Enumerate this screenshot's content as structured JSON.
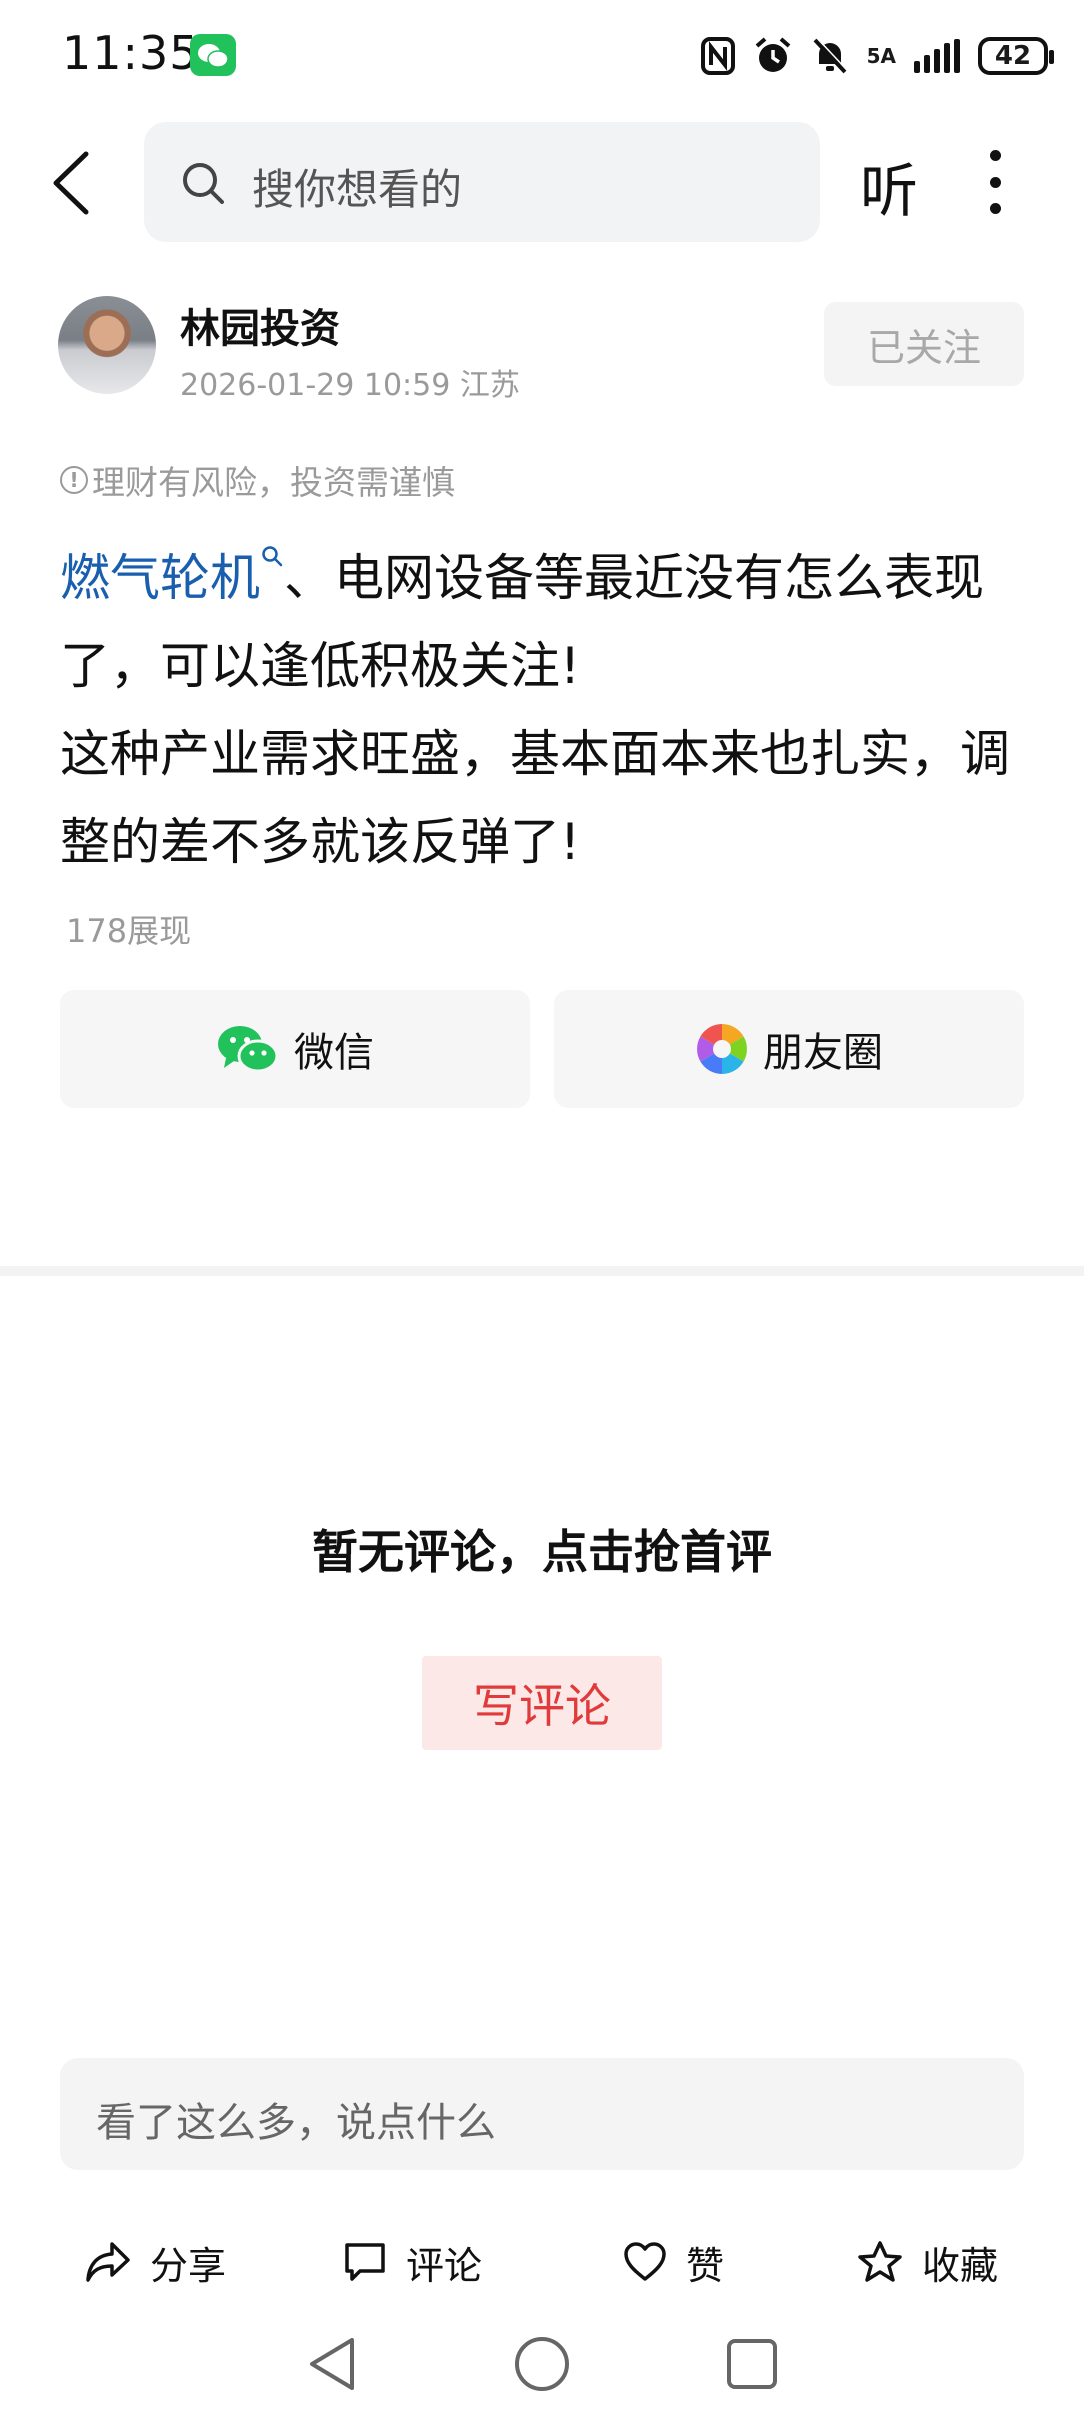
{
  "status_bar": {
    "time": "11:35",
    "network": "5A",
    "battery": "42",
    "icons": [
      "wechat-notification-icon",
      "nfc-icon",
      "alarm-icon",
      "mute-icon",
      "signal-icon",
      "battery-icon"
    ]
  },
  "top_nav": {
    "search_placeholder": "搜你想看的",
    "listen_label": "听"
  },
  "author": {
    "name": "林园投资",
    "meta": "2026-01-29 10:59 江苏",
    "follow_label": "已关注"
  },
  "risk_notice": "理财有风险，投资需谨慎",
  "post": {
    "topic": "燃气轮机",
    "line1_rest": "、电网设备等最近没有怎么表现了，可以逢低积极关注!",
    "line2": "这种产业需求旺盛，基本面本来也扎实，调整的差不多就该反弹了!"
  },
  "views": "178展现",
  "share": {
    "wechat_label": "微信",
    "moments_label": "朋友圈"
  },
  "comments": {
    "empty_text": "暂无评论，点击抢首评",
    "write_label": "写评论",
    "input_placeholder": "看了这么多，说点什么"
  },
  "actions": {
    "share": "分享",
    "comment": "评论",
    "like": "赞",
    "favorite": "收藏"
  },
  "colors": {
    "topic_link": "#1a5fae",
    "write_button_text": "#e03a3a",
    "write_button_bg": "#fde8e8",
    "wechat_green": "#21c15c"
  }
}
